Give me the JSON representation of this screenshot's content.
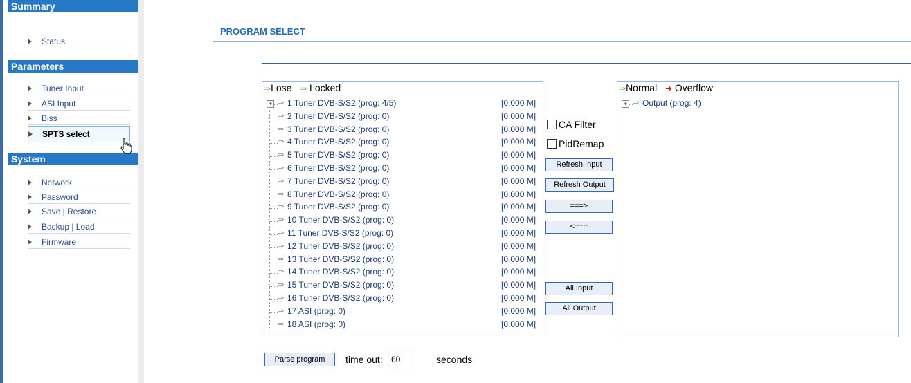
{
  "sidebar": {
    "sections": [
      {
        "title": "Summary",
        "items": [
          "Status"
        ]
      },
      {
        "title": "Parameters",
        "items": [
          "Tuner Input",
          "ASI Input",
          "Biss",
          "SPTS select"
        ]
      },
      {
        "title": "System",
        "items": [
          "Network",
          "Password",
          "Save | Restore",
          "Backup | Load",
          "Firmware"
        ]
      }
    ],
    "active_item": "SPTS select"
  },
  "main": {
    "title": "PROGRAM SELECT",
    "input_panel": {
      "legend_lose": "Lose",
      "legend_locked": "Locked",
      "items": [
        {
          "name": "1 Tuner DVB-S/S2 (prog: 4/5)",
          "rate": "[0.000 M]"
        },
        {
          "name": "2 Tuner DVB-S/S2 (prog: 0)",
          "rate": "[0.000 M]"
        },
        {
          "name": "3 Tuner DVB-S/S2 (prog: 0)",
          "rate": "[0.000 M]"
        },
        {
          "name": "4 Tuner DVB-S/S2 (prog: 0)",
          "rate": "[0.000 M]"
        },
        {
          "name": "5 Tuner DVB-S/S2 (prog: 0)",
          "rate": "[0.000 M]"
        },
        {
          "name": "6 Tuner DVB-S/S2 (prog: 0)",
          "rate": "[0.000 M]"
        },
        {
          "name": "7 Tuner DVB-S/S2 (prog: 0)",
          "rate": "[0.000 M]"
        },
        {
          "name": "8 Tuner DVB-S/S2 (prog: 0)",
          "rate": "[0.000 M]"
        },
        {
          "name": "9 Tuner DVB-S/S2 (prog: 0)",
          "rate": "[0.000 M]"
        },
        {
          "name": "10 Tuner DVB-S/S2 (prog: 0)",
          "rate": "[0.000 M]"
        },
        {
          "name": "11 Tuner DVB-S/S2 (prog: 0)",
          "rate": "[0.000 M]"
        },
        {
          "name": "12 Tuner DVB-S/S2 (prog: 0)",
          "rate": "[0.000 M]"
        },
        {
          "name": "13 Tuner DVB-S/S2 (prog: 0)",
          "rate": "[0.000 M]"
        },
        {
          "name": "14 Tuner DVB-S/S2 (prog: 0)",
          "rate": "[0.000 M]"
        },
        {
          "name": "15 Tuner DVB-S/S2 (prog: 0)",
          "rate": "[0.000 M]"
        },
        {
          "name": "16 Tuner DVB-S/S2 (prog: 0)",
          "rate": "[0.000 M]"
        },
        {
          "name": "17 ASI (prog: 0)",
          "rate": "[0.000 M]"
        },
        {
          "name": "18 ASI (prog: 0)",
          "rate": "[0.000 M]"
        }
      ]
    },
    "controls": {
      "ca_filter": "CA Filter",
      "pid_remap": "PidRemap",
      "refresh_input": "Refresh Input",
      "refresh_output": "Refresh Output",
      "move_right": "===>",
      "move_left": "<===",
      "all_input": "All Input",
      "all_output": "All Output"
    },
    "output_panel": {
      "legend_normal": "Normal",
      "legend_overflow": "Overflow",
      "items": [
        {
          "name": "Output (prog: 4)"
        }
      ]
    },
    "footer": {
      "parse_button": "Parse program",
      "timeout_label": "time out:",
      "timeout_value": "60",
      "seconds_label": "seconds"
    }
  },
  "colors": {
    "accent": "#2878c8",
    "locked_arrow": "#3cb043",
    "overflow_arrow": "#cc1111"
  }
}
